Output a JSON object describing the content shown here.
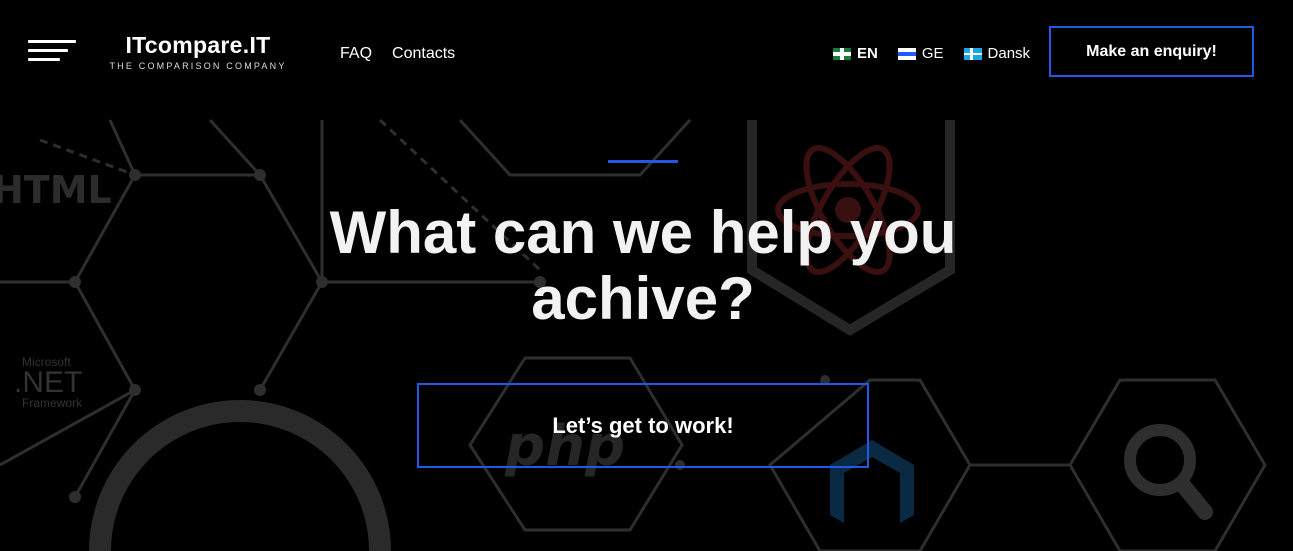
{
  "header": {
    "logo_name": "ITcompare.IT",
    "logo_tagline": "THE COMPARISON COMPANY",
    "nav": [
      {
        "label": "FAQ"
      },
      {
        "label": "Contacts"
      }
    ],
    "languages": [
      {
        "label": "EN",
        "flag": "uk-flag-icon",
        "active": true
      },
      {
        "label": "GE",
        "flag": "ge-flag-icon",
        "active": false
      },
      {
        "label": "Dansk",
        "flag": "dk-flag-icon",
        "active": false
      }
    ],
    "enquiry_label": "Make an enquiry!"
  },
  "hero": {
    "title": "What can we help you achive?",
    "cta_label": "Let’s get to work!"
  },
  "background": {
    "tech_labels": [
      "HTML",
      "Microsoft",
      ".NET",
      "Framework",
      "php"
    ],
    "tech_icons": [
      "react-icon",
      "magento-icon",
      "search-icon"
    ]
  },
  "colors": {
    "accent": "#2357e6",
    "background": "#000000",
    "text": "#ffffff"
  }
}
